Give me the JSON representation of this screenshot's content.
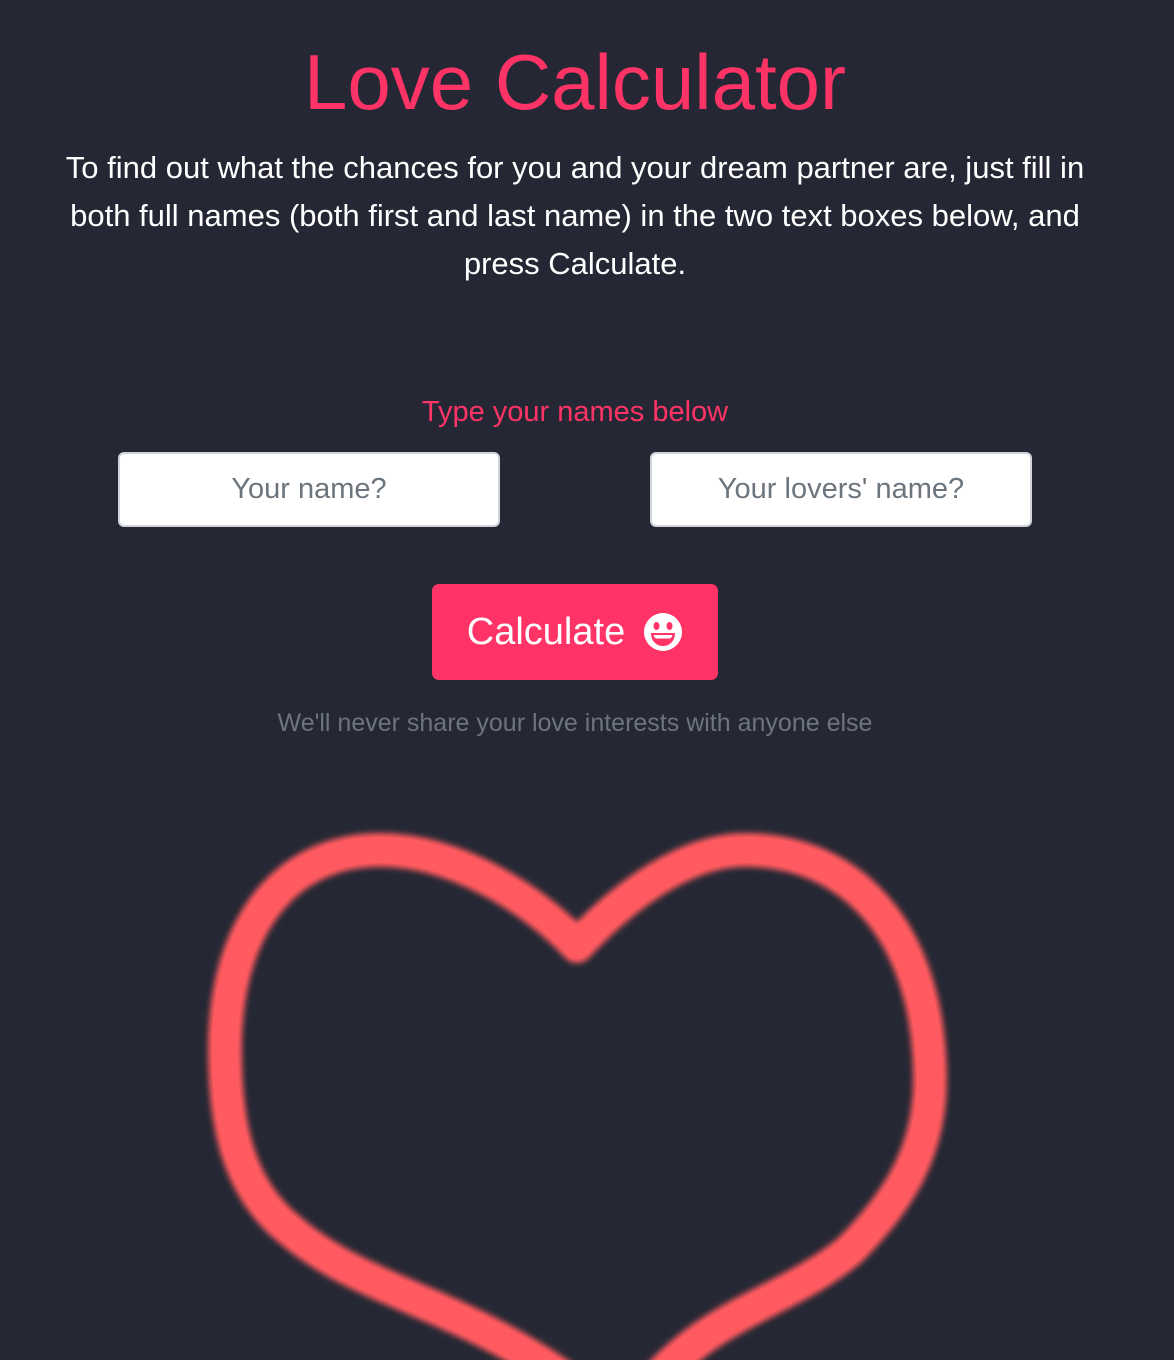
{
  "header": {
    "title": "Love Calculator",
    "intro": "To find out what the chances for you and your dream partner are, just fill in both full names (both first and last name) in the two text boxes below, and press Calculate."
  },
  "form": {
    "prompt": "Type your names below",
    "your_name_placeholder": "Your name?",
    "lover_name_placeholder": "Your lovers' name?",
    "your_name_value": "",
    "lover_name_value": "",
    "calculate_label": "Calculate",
    "calculate_icon": "grinning-face-icon",
    "privacy_note": "We'll never share your love interests with anyone else"
  },
  "decoration": {
    "icon": "heart-outline-icon"
  },
  "colors": {
    "background": "#252834",
    "accent": "#ff3366",
    "heart": "#ff5a5f",
    "muted": "#6c757d"
  }
}
